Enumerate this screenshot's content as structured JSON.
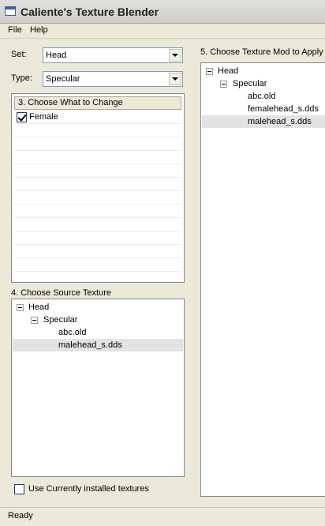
{
  "window": {
    "title": "Caliente's Texture Blender"
  },
  "menu": {
    "items": [
      "File",
      "Help"
    ]
  },
  "set": {
    "label": "Set:",
    "value": "Head"
  },
  "type": {
    "label": "Type:",
    "value": "Specular"
  },
  "change_panel": {
    "header": "3. Choose What to Change",
    "items": [
      {
        "label": "Female",
        "checked": true
      }
    ]
  },
  "source_panel": {
    "label": "4. Choose Source Texture",
    "tree": {
      "root": "Head",
      "child": "Specular",
      "leaves": [
        "abc.old",
        "malehead_s.dds"
      ],
      "selected": "malehead_s.dds"
    }
  },
  "use_installed": {
    "label": "Use Currently installed textures",
    "checked": false
  },
  "mod_panel": {
    "label": "5. Choose Texture Mod to Apply",
    "tree": {
      "root": "Head",
      "child": "Specular",
      "leaves": [
        "abc.old",
        "femalehead_s.dds",
        "malehead_s.dds"
      ],
      "selected": "malehead_s.dds"
    }
  },
  "status": {
    "text": "Ready"
  }
}
